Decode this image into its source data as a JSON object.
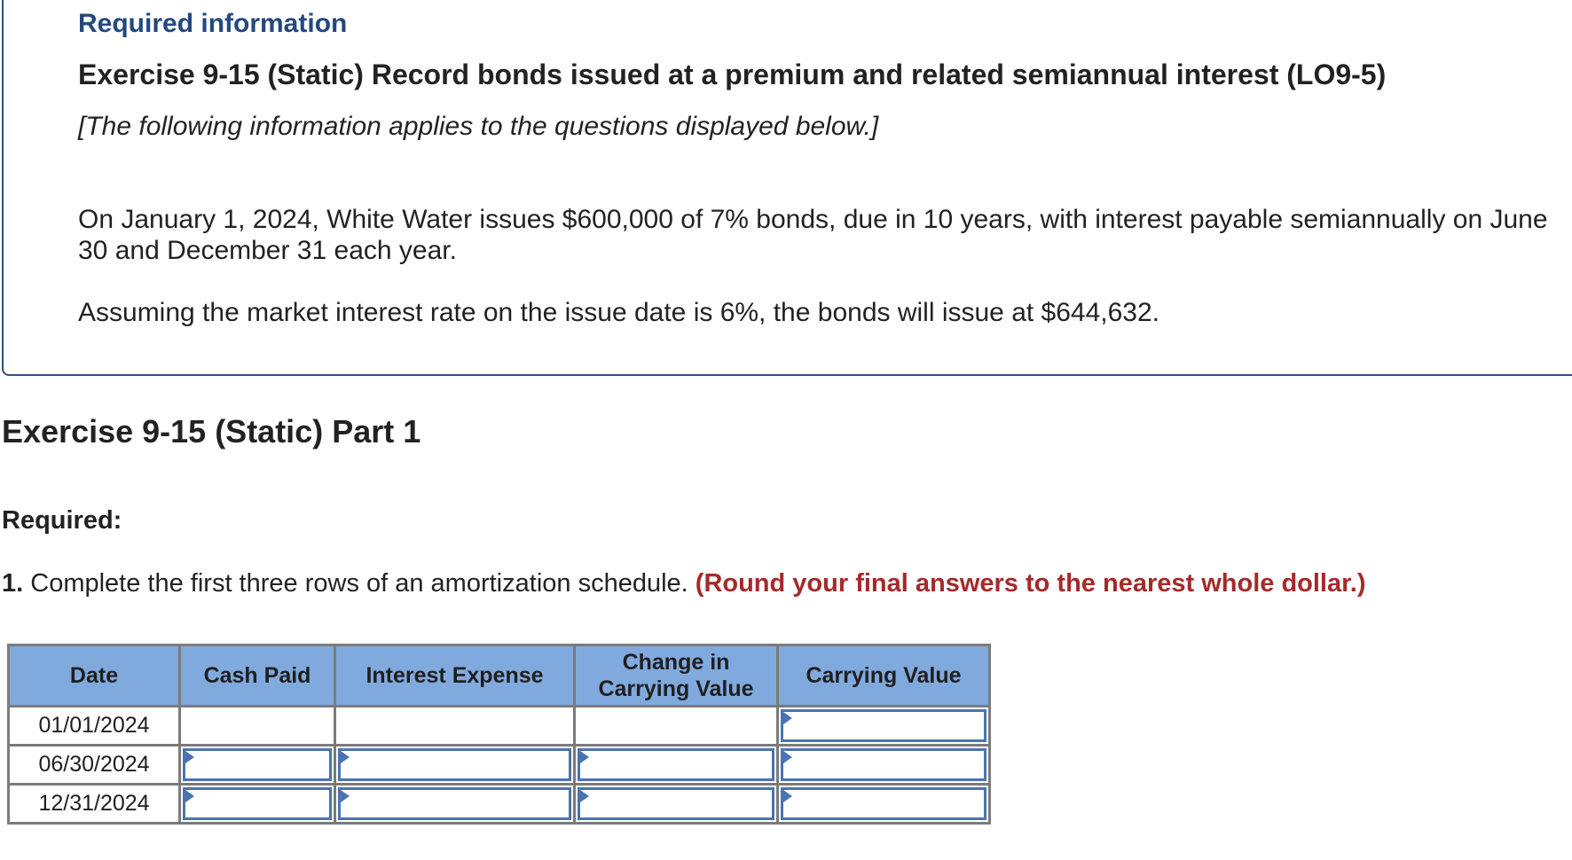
{
  "header": {
    "required_information": "Required information",
    "title": "Exercise 9-15 (Static) Record bonds issued at a premium and related semiannual interest (LO9-5)",
    "subtitle": "[The following information applies to the questions displayed below.]",
    "paragraph1": "On January 1, 2024, White Water issues $600,000 of 7% bonds, due in 10 years, with interest payable semiannually on June 30 and December 31 each year.",
    "paragraph2": "Assuming the market interest rate on the issue date is 6%, the bonds will issue at $644,632."
  },
  "part": {
    "title": "Exercise 9-15 (Static) Part 1",
    "required_label": "Required:",
    "question_number": "1.",
    "question_text": " Complete the first three rows of an amortization schedule. ",
    "question_instruction": "(Round your final answers to the nearest whole dollar.)"
  },
  "table": {
    "columns": [
      "Date",
      "Cash Paid",
      "Interest Expense",
      "Change in Carrying Value",
      "Carrying Value"
    ],
    "rows": [
      {
        "date": "01/01/2024",
        "cash_paid": "",
        "interest_expense": "",
        "change_in_carrying_value": "",
        "carrying_value": ""
      },
      {
        "date": "06/30/2024",
        "cash_paid": "",
        "interest_expense": "",
        "change_in_carrying_value": "",
        "carrying_value": ""
      },
      {
        "date": "12/31/2024",
        "cash_paid": "",
        "interest_expense": "",
        "change_in_carrying_value": "",
        "carrying_value": ""
      }
    ]
  },
  "colors": {
    "header_blue": "#24497f",
    "table_header_bg": "#80aade",
    "input_border": "#4a74b0",
    "instruction_red": "#a52a2a"
  }
}
